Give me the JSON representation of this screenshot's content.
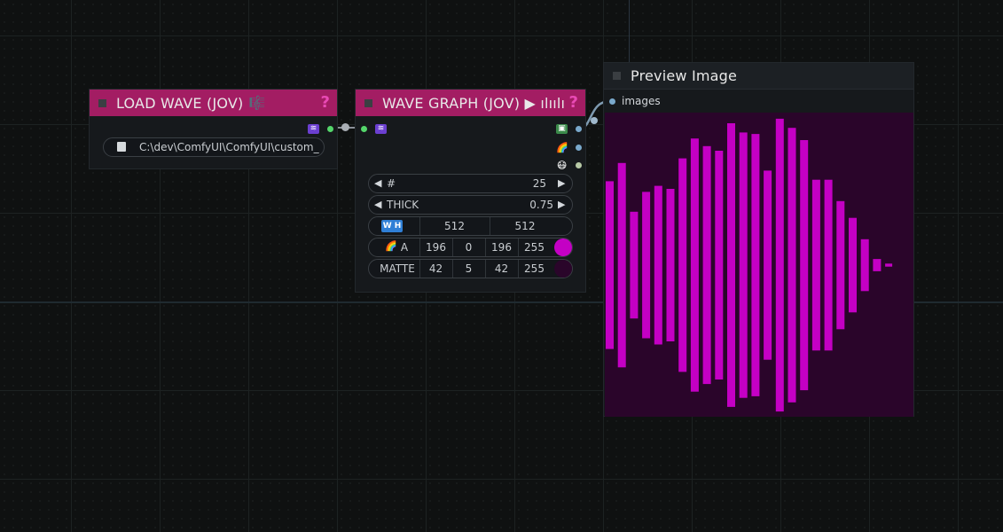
{
  "nodes": {
    "load_wave": {
      "title": "LOAD WAVE (JOV)",
      "title_icon": "🎼",
      "help": "?",
      "file_icon": "floppy-disk-icon",
      "file_value": "C:\\dev\\ComfyUI\\ComfyUI\\custom_",
      "header_color": "#a31d63"
    },
    "wave_graph": {
      "title": "WAVE GRAPH (JOV) ▶ ılıılı",
      "help": "?",
      "count_label": "#",
      "count_value": "25",
      "thick_label": "THICK",
      "thick_value": "0.75",
      "wh_label": "W H",
      "width": "512",
      "height": "512",
      "rgba_label": "A",
      "rgba": [
        "196",
        "0",
        "196",
        "255"
      ],
      "rgba_color": "#c400c4",
      "matte_label": "MATTE",
      "matte": [
        "42",
        "5",
        "42",
        "255"
      ],
      "matte_color": "#2a052a",
      "header_color": "#a31d63"
    },
    "preview": {
      "title": "Preview Image",
      "input_label": "images",
      "background": "#2a052a",
      "bar_color": "#c400c4"
    }
  },
  "waveform": {
    "bar_count": 25,
    "amplitudes": [
      0.55,
      0.67,
      0.35,
      0.48,
      0.52,
      0.5,
      0.7,
      0.83,
      0.78,
      0.75,
      0.93,
      0.87,
      0.86,
      0.62,
      0.96,
      0.9,
      0.82,
      0.56,
      0.56,
      0.42,
      0.31,
      0.17,
      0.04,
      0.01
    ]
  }
}
